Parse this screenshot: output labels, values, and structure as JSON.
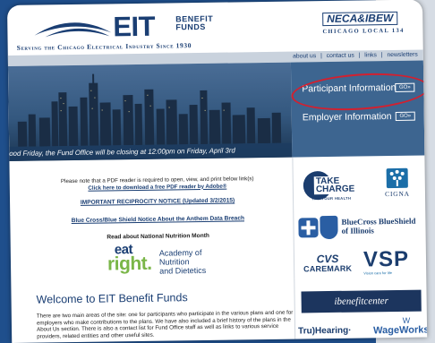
{
  "header": {
    "logo_main": "EIT",
    "logo_side_1": "BENEFIT",
    "logo_side_2": "FUNDS",
    "tagline": "Serving the Chicago Electrical Industry Since 1930",
    "union_logo_top": "NECA&IBEW",
    "union_logo_sub": "CHICAGO   LOCAL 134"
  },
  "nav": {
    "about": "about us",
    "contact": "contact us",
    "links": "links",
    "newsletters": "newsletters",
    "separator": "|"
  },
  "hero": {
    "ticker": "ood Friday, the Fund Office will be closing at 12:00pm on Friday, April 3rd",
    "participant_label": "Participant Information",
    "employer_label": "Employer Information",
    "go_label": "GO»"
  },
  "main": {
    "pdf_note": "Please note that a PDF reader is required to open, view, and print below link(s)",
    "pdf_click": "Click here to download a free PDF reader by Adobe®",
    "notice_reciprocity": "IMPORTANT RECIPROCITY NOTICE (Updated 3/2/2015)",
    "notice_bcbs": "Blue Cross/Blue Shield Notice About the Anthem Data Breach",
    "nutrition_label": "Read about National Nutrition Month",
    "eatright_eat": "eat",
    "eatright_right": "right.",
    "eatright_academy_1": "Academy of Nutrition",
    "eatright_academy_2": "and Dietetics",
    "welcome_title": "Welcome to EIT Benefit Funds",
    "welcome_body": "There are two main areas of the site: one for participants who participate in the various plans and one for employers who make contributions to the plans. We have also included a brief history of the plans in the About Us section. There is also a contact list for Fund Office staff as well as links to various service providers, related entities and other useful sites."
  },
  "partners": {
    "take_charge_1": "TAKE",
    "take_charge_2": "CHARGE",
    "take_charge_sub": "IT'S YOUR HEALTH",
    "cigna": "CIGNA",
    "bcbs_1": "BlueCross BlueShield",
    "bcbs_2": "of Illinois",
    "cvs_1": "CVS",
    "cvs_2": "CAREMARK",
    "vsp": "VSP",
    "vsp_sub": "Vision care for life",
    "ibenefit": "ibenefitcenter",
    "truhearing": "Tru)Hearing·",
    "wageworks": "WageWorks"
  },
  "colors": {
    "brand_navy": "#1a3e73",
    "page_bg": "#1f4f8c",
    "highlight_circle": "#d3202f"
  }
}
